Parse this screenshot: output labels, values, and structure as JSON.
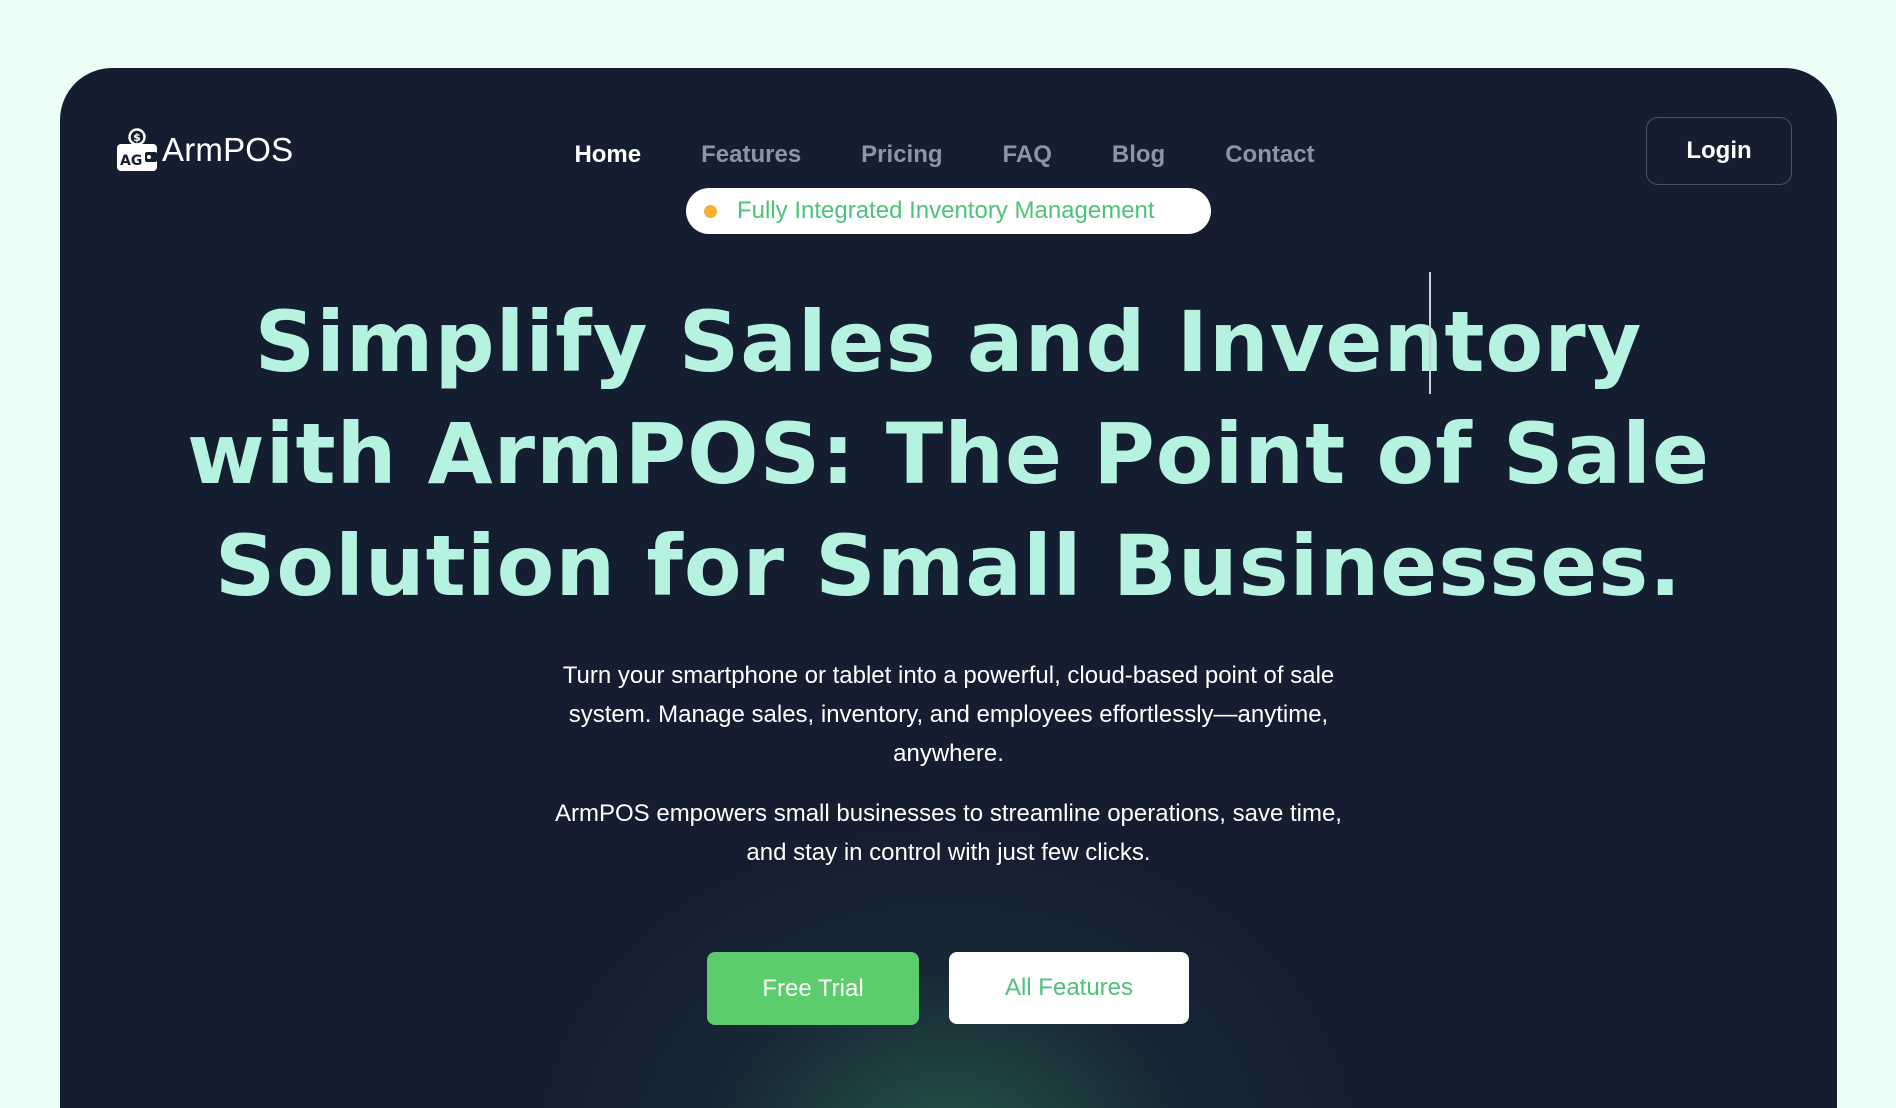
{
  "brand": {
    "name": "ArmPOS",
    "logo_icon": "wallet-dollar-icon",
    "logo_letters": "AG"
  },
  "nav": {
    "items": [
      {
        "label": "Home",
        "active": true
      },
      {
        "label": "Features",
        "active": false
      },
      {
        "label": "Pricing",
        "active": false
      },
      {
        "label": "FAQ",
        "active": false
      },
      {
        "label": "Blog",
        "active": false
      },
      {
        "label": "Contact",
        "active": false
      }
    ],
    "login_label": "Login"
  },
  "hero": {
    "badge": "Fully Integrated Inventory Management",
    "headline_lines": [
      "Simplify Sales and Inventory",
      "with ArmPOS: The Point of Sale",
      "Solution for Small Businesses."
    ],
    "description_1_lines": [
      "Turn your smartphone or tablet into a powerful, cloud-based point of sale",
      "system. Manage sales, inventory, and employees effortlessly—anytime,",
      "anywhere."
    ],
    "description_2_lines": [
      "ArmPOS empowers small businesses to streamline operations, save time,",
      "and stay in control with just few clicks."
    ],
    "primary_cta": "Free Trial",
    "secondary_cta": "All Features"
  },
  "colors": {
    "page_bg": "#ebfff6",
    "panel_bg": "#151e31",
    "headline": "#b5f2e0",
    "accent_green": "#5ccc6c",
    "badge_text": "#4ec27a",
    "badge_dot": "#f2b02e",
    "nav_inactive": "#8d94a2"
  }
}
